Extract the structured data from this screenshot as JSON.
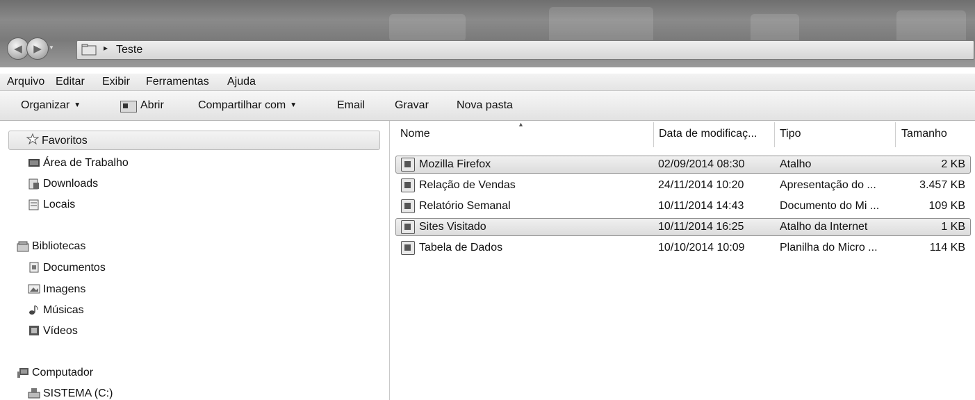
{
  "address": {
    "path": "Teste",
    "separator": "▸"
  },
  "menu": [
    "Arquivo",
    "Editar",
    "Exibir",
    "Ferramentas",
    "Ajuda"
  ],
  "toolbar": {
    "organizar": "Organizar",
    "abrir": "Abrir",
    "compartilhar": "Compartilhar com",
    "email": "Email",
    "gravar": "Gravar",
    "nova_pasta": "Nova pasta",
    "dropdown_arrow": "▼"
  },
  "sidebar": {
    "favoritos": "Favoritos",
    "favoritos_items": [
      "Área de Trabalho",
      "Downloads",
      "Locais"
    ],
    "bibliotecas": "Bibliotecas",
    "bibliotecas_items": [
      "Documentos",
      "Imagens",
      "Músicas",
      "Vídeos"
    ],
    "computador": "Computador",
    "computador_items": [
      "SISTEMA (C:)"
    ]
  },
  "columns": [
    "Nome",
    "Data de modificaç...",
    "Tipo",
    "Tamanho"
  ],
  "files": [
    {
      "name": "Mozilla Firefox",
      "date": "02/09/2014 08:30",
      "type": "Atalho",
      "size": "2 KB",
      "icon": "shortcut-icon"
    },
    {
      "name": "Relação de Vendas",
      "date": "24/11/2014 10:20",
      "type": "Apresentação do ...",
      "size": "3.457 KB",
      "icon": "presentation-icon"
    },
    {
      "name": "Relatório Semanal",
      "date": "10/11/2014 14:43",
      "type": "Documento do Mi ...",
      "size": "109 KB",
      "icon": "document-icon"
    },
    {
      "name": "Sites Visitado",
      "date": "10/11/2014 16:25",
      "type": "Atalho da Internet",
      "size": "1 KB",
      "icon": "internet-shortcut-icon"
    },
    {
      "name": "Tabela de Dados",
      "date": "10/10/2014 10:09",
      "type": "Planilha do Micro ...",
      "size": "114 KB",
      "icon": "spreadsheet-icon"
    }
  ]
}
